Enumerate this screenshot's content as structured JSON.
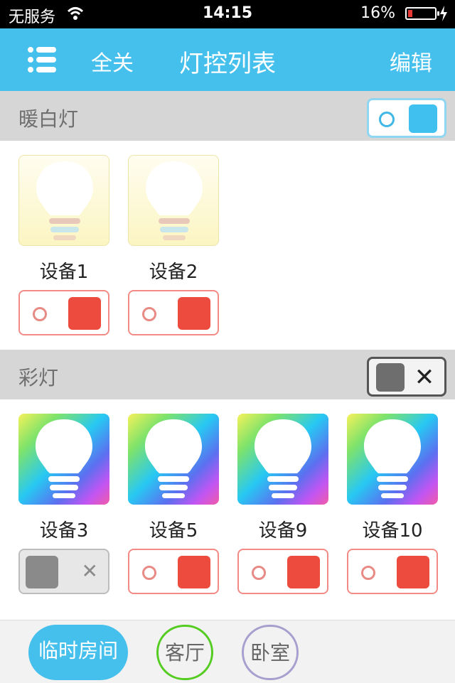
{
  "status_bar": {
    "carrier": "无服务",
    "time": "14:15",
    "battery": "16%",
    "battery_level": 0.16
  },
  "nav": {
    "all_off": "全关",
    "title": "灯控列表",
    "edit": "编辑"
  },
  "groups": [
    {
      "title": "暖白灯",
      "toggle_state": "on",
      "devices": [
        {
          "name": "设备1",
          "state": "on"
        },
        {
          "name": "设备2",
          "state": "on"
        }
      ]
    },
    {
      "title": "彩灯",
      "toggle_state": "off",
      "devices": [
        {
          "name": "设备3",
          "state": "off"
        },
        {
          "name": "设备5",
          "state": "on"
        },
        {
          "name": "设备9",
          "state": "on"
        },
        {
          "name": "设备10",
          "state": "on"
        }
      ]
    }
  ],
  "rooms": [
    {
      "label": "临时房间",
      "active": true
    },
    {
      "label": "客厅",
      "active": false
    },
    {
      "label": "卧室",
      "active": false
    }
  ],
  "colors": {
    "primary": "#45c0ec",
    "switch_on": "#ec4b3d",
    "switch_off": "#8a8a8a",
    "living_room_ring": "#55cc22",
    "bedroom_ring": "#a89fcf"
  }
}
